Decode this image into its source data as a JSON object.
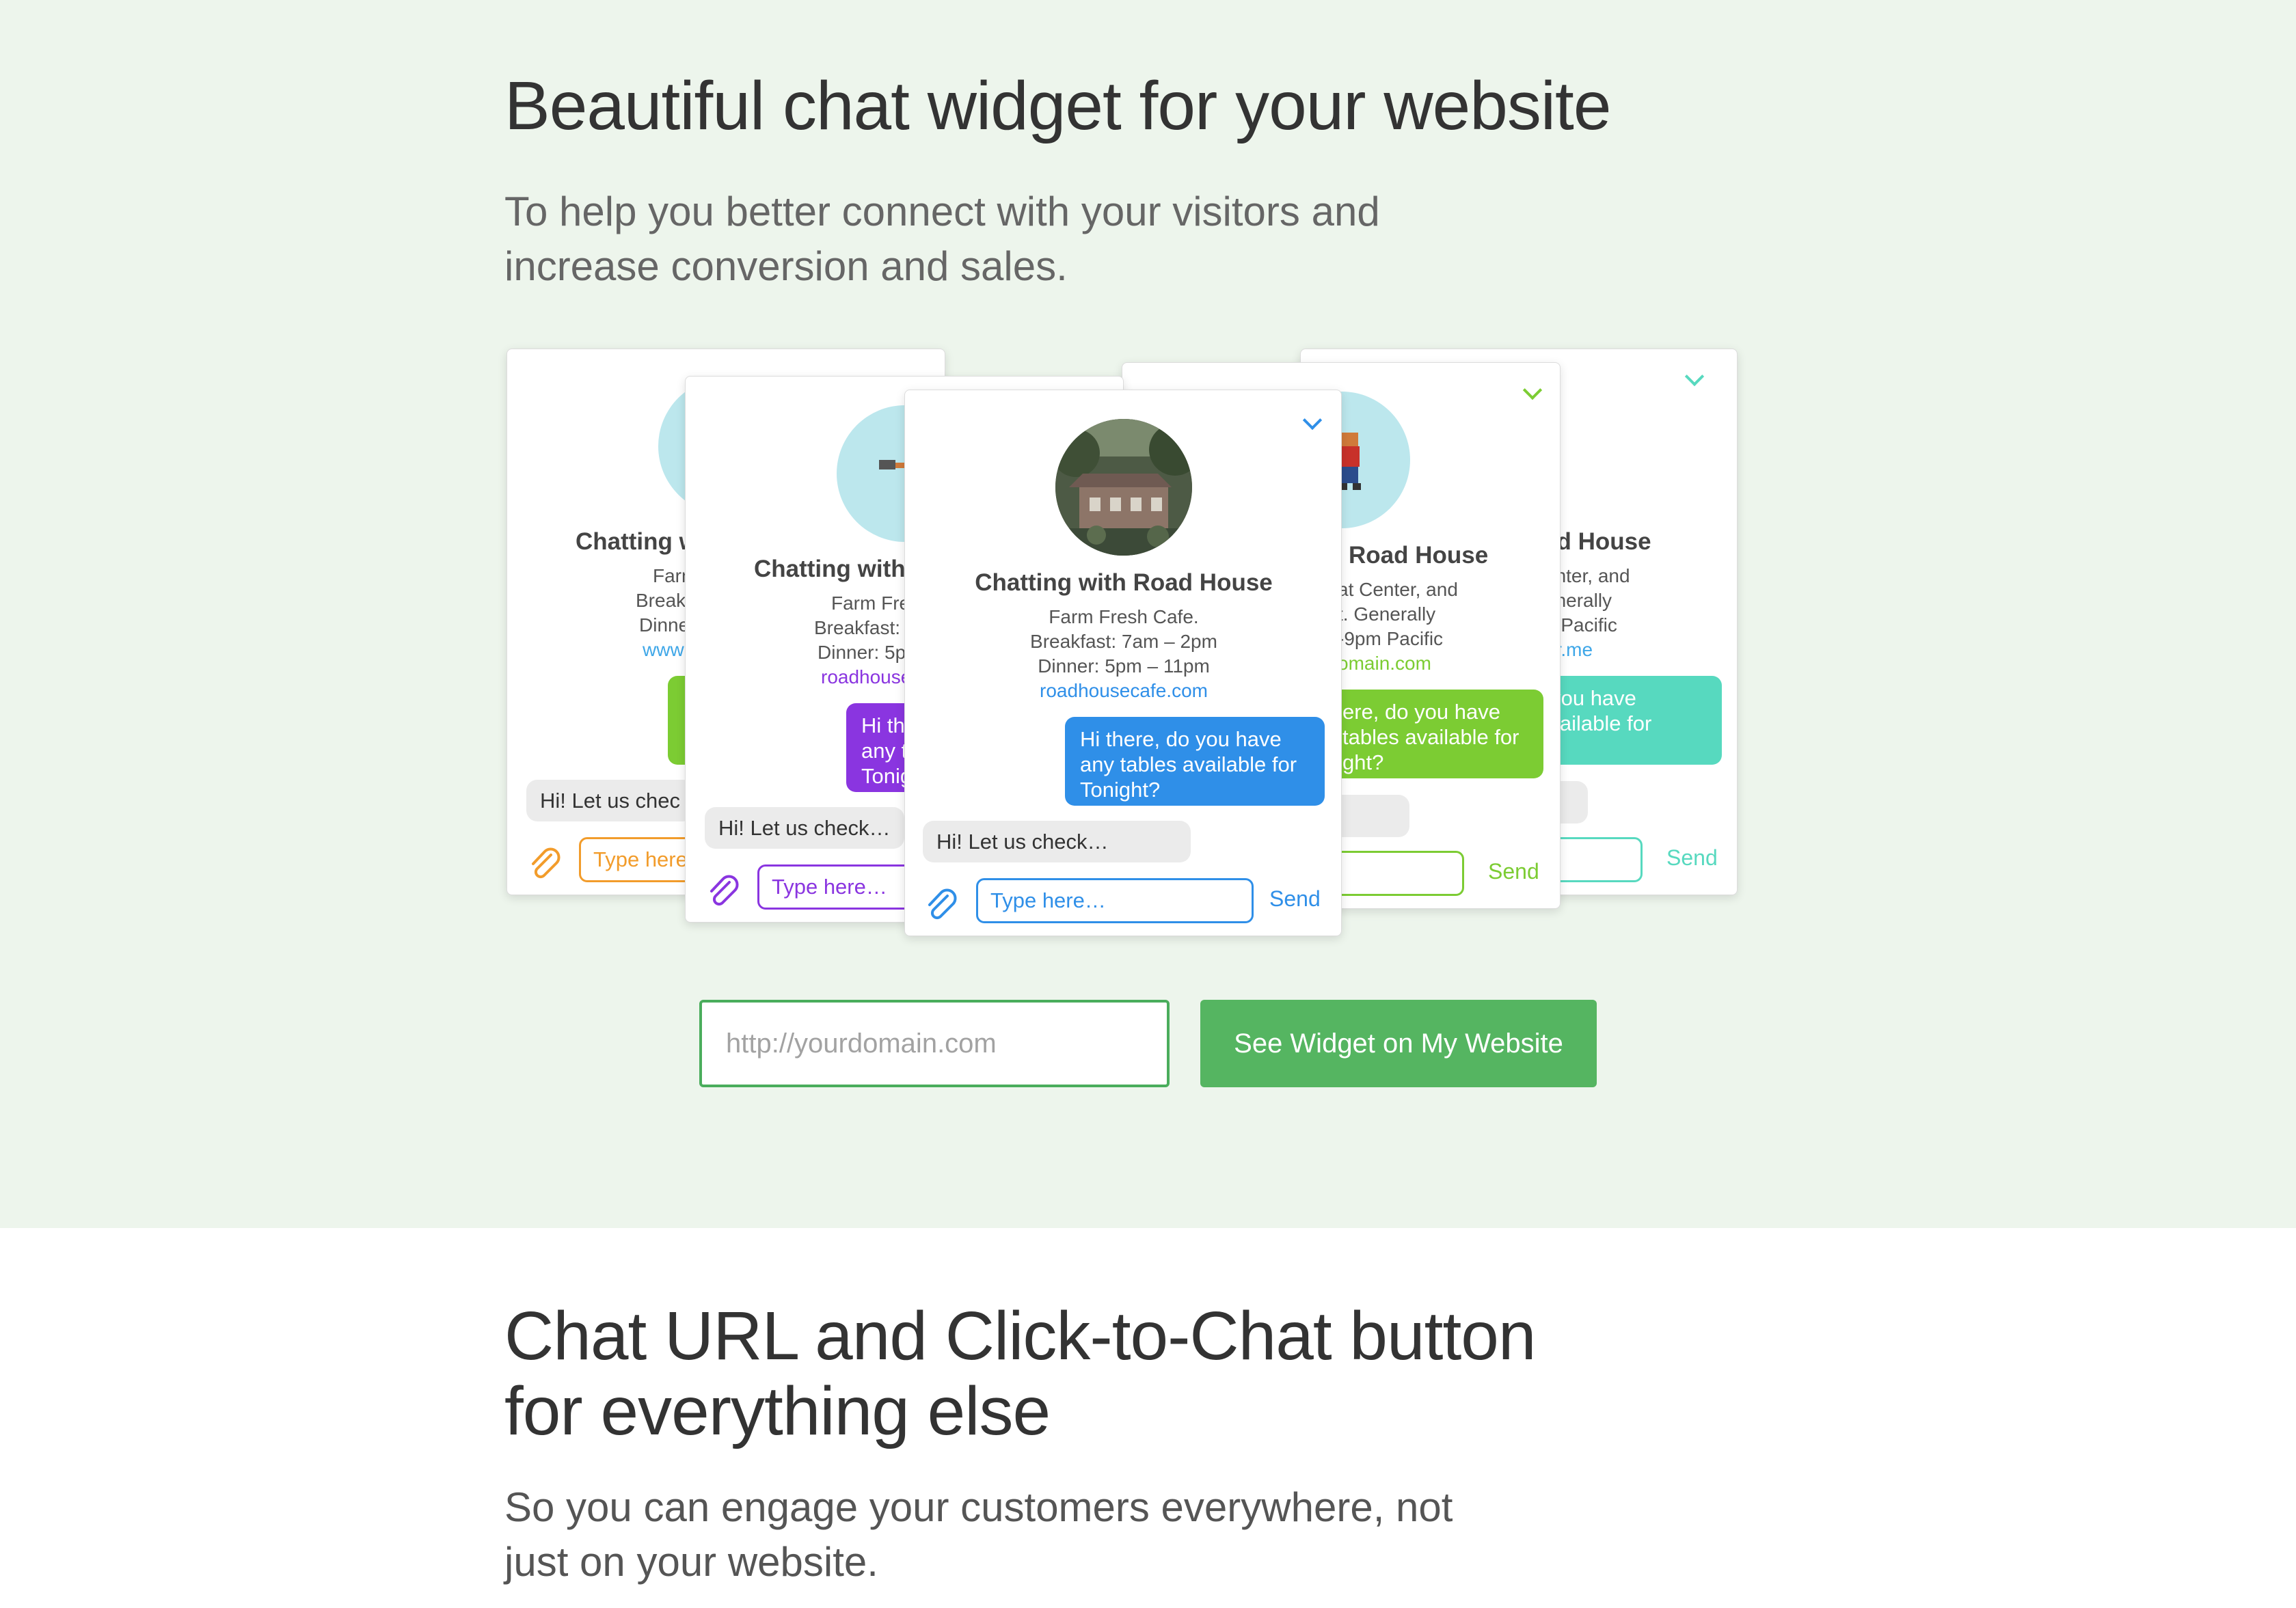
{
  "hero": {
    "title": "Beautiful chat widget for your website",
    "subtitle": "To help you better connect with your visitors and increase conversion and sales."
  },
  "cards": [
    {
      "accent": "#f29c2b",
      "title_partial": "Chatting w",
      "lines": [
        "Farm",
        "Break",
        "Dinne"
      ],
      "link_partial": "www",
      "incoming_partial": "Hi! Let us chec",
      "placeholder_partial": "Type here"
    },
    {
      "accent": "#8a35e0",
      "title_partial": "Chatting with",
      "lines": [
        "Farm Fre",
        "Breakfast: ",
        "Dinner: 5p"
      ],
      "link_partial": "roadhouse",
      "bubble_lines": [
        "Hi th",
        "any t",
        "Tonig"
      ],
      "incoming": "Hi! Let us check…",
      "placeholder": "Type here…"
    },
    {
      "accent": "#2f8fe8",
      "title": "Chatting with Road House",
      "lines": [
        "Farm Fresh Cafe.",
        "Breakfast: 7am – 2pm",
        "Dinner: 5pm – 11pm"
      ],
      "link": "roadhousecafe.com",
      "bubble_lines": [
        "Hi there, do you have",
        "any tables available for",
        "Tonight?"
      ],
      "incoming": "Hi! Let us check…",
      "placeholder": "Type here…",
      "send": "Send"
    },
    {
      "accent": "#7ccc33",
      "title_partial": "Road House",
      "lines": [
        "at Center, and",
        "t. Generally",
        "-9pm Pacific"
      ],
      "link_partial": "omain.com",
      "bubble_lines": [
        "ere, do you have",
        "tables available for",
        "ght?"
      ],
      "send": "Send"
    },
    {
      "accent": "#57d9bf",
      "title_partial": "ad House",
      "lines": [
        "enter, and",
        "enerally",
        "n Pacific"
      ],
      "link_partial": "er.me",
      "bubble_lines": [
        "do you have",
        "s available for"
      ],
      "send": "Send"
    }
  ],
  "cta": {
    "placeholder": "http://yourdomain.com",
    "button": "See Widget on My Website"
  },
  "section2": {
    "title": "Chat URL and Click-to-Chat button for everything else",
    "subtitle": "So you can engage your customers everywhere, not just on your website."
  },
  "colors": {
    "hero_bg": "#edf5ec",
    "primary_green": "#55b561"
  }
}
